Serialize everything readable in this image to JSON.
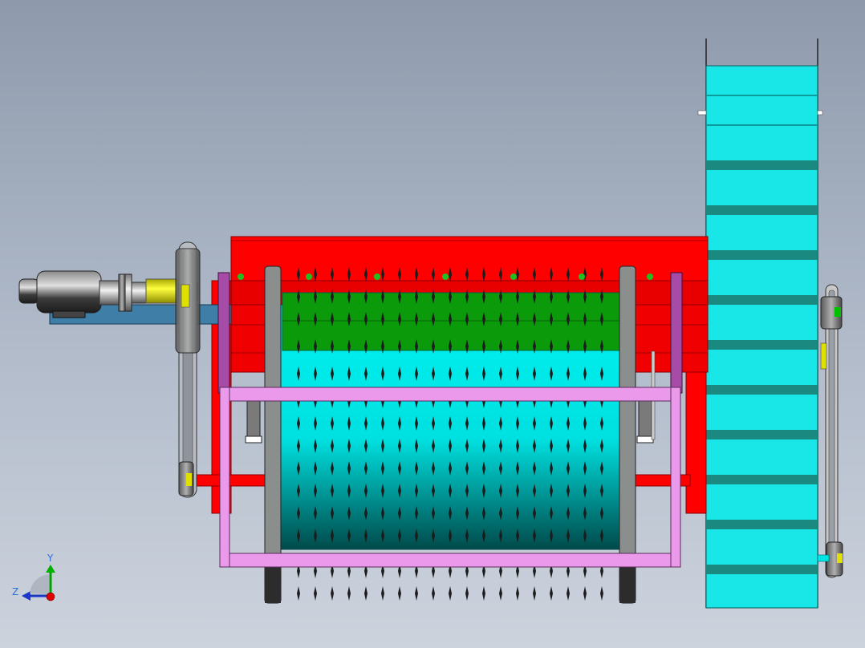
{
  "triad": {
    "y_label": "Y",
    "z_label": "Z"
  },
  "colors": {
    "background_top": "#8e9aac",
    "background_bottom": "#cdd3dd",
    "housing": "#ff0000",
    "drum": "#00e6e6",
    "drum_dark": "#006a6a",
    "green_band": "#00a000",
    "frame": "#e98fe9",
    "plate": "#3f7fa7",
    "coupling": "#f0f000",
    "motor": "#4a4a4a",
    "roller": "#19c0c0",
    "roller_band": "#1a8a80",
    "teeth": "#1c1c1c"
  }
}
